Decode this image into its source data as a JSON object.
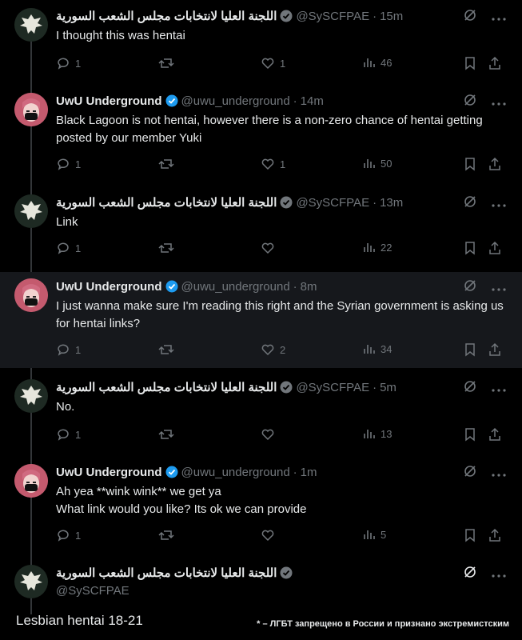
{
  "tweets": [
    {
      "name": "اللجنة العليا لانتخابات مجلس الشعب السورية",
      "handle": "@SySCFPAE",
      "time": "15m",
      "text": "I thought this was hentai",
      "replies": "1",
      "retweets": "",
      "likes": "1",
      "views": "46",
      "avatar": "eagle-emblem"
    },
    {
      "name": "UwU Underground",
      "handle": "@uwu_underground",
      "time": "14m",
      "text": "Black Lagoon is not hentai, however there is a non-zero chance of hentai getting posted by our member Yuki",
      "replies": "1",
      "retweets": "",
      "likes": "1",
      "views": "50",
      "avatar": "anime-girl-mask"
    },
    {
      "name": "اللجنة العليا لانتخابات مجلس الشعب السورية",
      "handle": "@SySCFPAE",
      "time": "13m",
      "text": "Link",
      "replies": "1",
      "retweets": "",
      "likes": "",
      "views": "22",
      "avatar": "eagle-emblem"
    },
    {
      "name": "UwU Underground",
      "handle": "@uwu_underground",
      "time": "8m",
      "text": "I just wanna make sure I'm reading this right and the Syrian government is asking us for hentai links?",
      "replies": "1",
      "retweets": "",
      "likes": "2",
      "views": "34",
      "avatar": "anime-girl-mask"
    },
    {
      "name": "اللجنة العليا لانتخابات مجلس الشعب السورية",
      "handle": "@SySCFPAE",
      "time": "5m",
      "text": "No.",
      "replies": "1",
      "retweets": "",
      "likes": "",
      "views": "13",
      "avatar": "eagle-emblem"
    },
    {
      "name": "UwU Underground",
      "handle": "@uwu_underground",
      "time": "1m",
      "text_line1": "Ah yea **wink wink** we get ya",
      "text_line2": "What link would you like? Its ok we can provide",
      "replies": "1",
      "retweets": "",
      "likes": "",
      "views": "5",
      "avatar": "anime-girl-mask"
    },
    {
      "name": "اللجنة العليا لانتخابات مجلس الشعب السورية",
      "handle": "@SySCFPAE",
      "avatar": "eagle-emblem"
    }
  ],
  "footer": {
    "caption": "Lesbian hentai 18-21",
    "disclaimer": "* – ЛГБТ запрещено в России и признано экстремистским"
  },
  "colors": {
    "background": "#000000",
    "text": "#e7e9ea",
    "muted": "#71767b",
    "verified": "#1d9bf0"
  }
}
